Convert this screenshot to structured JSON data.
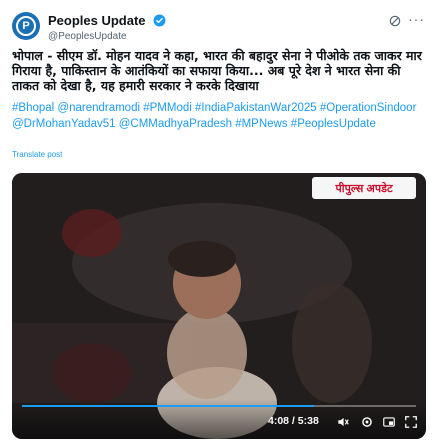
{
  "tweet": {
    "display_name": "Peoples Update",
    "handle": "@PeoplesUpdate",
    "avatar_letter": "P",
    "text": "भोपाल - सीएम डॉ. मोहन यादव ने कहा, भारत की बहादुर सेना ने पीओके तक जाकर मार गिराया है, पाकिस्तान के आतंकियों का सफाया किया... अब पूरे देश ने भारत सेना की ताकत को देखा है, यह हमारी सरकार ने करके दिखाया",
    "hashtags": "#Bhopal @narendramodi #PMModi #IndiaPakistanWar2025 #OperationSindoor @DrMohanYadav51 @CMMadhyaPradesh #MPNews #PeoplesUpdate",
    "translate_label": "Translate post"
  },
  "video": {
    "logo_text": "पीपुल्स अपडेट",
    "time_display": "4:08 / 5:38",
    "progress": 0.74
  },
  "icons": {
    "verified": "verified-badge-icon",
    "grok": "grok-icon",
    "more": "more-icon",
    "volume": "volume-icon",
    "settings": "settings-icon",
    "pip": "picture-in-picture-icon",
    "fullscreen": "fullscreen-icon"
  },
  "colors": {
    "accent": "#1d9bf0",
    "avatar": "#1a6fb5"
  }
}
